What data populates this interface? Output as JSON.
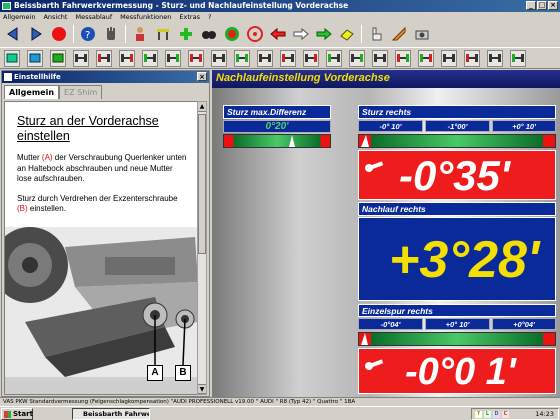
{
  "window": {
    "title": "Beissbarth Fahrwerkvermessung - Sturz- und Nachlaufeinstellung Vorderachse",
    "controls": [
      "_",
      "□",
      "×"
    ]
  },
  "menu": [
    "Allgemein",
    "Ansicht",
    "Messablauf",
    "Messfunktionen",
    "Extras",
    "?"
  ],
  "help": {
    "window_title": "Einstellhilfe",
    "tabs": [
      "Allgemein",
      "EZ Shim"
    ],
    "heading": "Sturz an der Vorderachse einstellen",
    "para1_a": "Mutter ",
    "para1_marker": "(A)",
    "para1_b": " der Verschraubung Querlenker unten an Haltebock abschrauben und neue Mutter lose aufschrauben.",
    "para2_a": "Sturz durch Verdrehen der Exzenterschraube ",
    "para2_marker": "(B)",
    "para2_b": " einstellen.",
    "callout_a": "A",
    "callout_b": "B"
  },
  "main": {
    "title": "Nachlaufeinstellung Vorderachse",
    "camber_diff": {
      "label": "Sturz max.Differenz",
      "value": "0°20'"
    },
    "camber_right": {
      "label": "Sturz rechts",
      "limits": [
        "-0° 10'",
        "-1°00'",
        "+0° 10'"
      ],
      "value": "-0°35'"
    },
    "caster_right": {
      "label": "Nachlauf rechts",
      "value": "+3°28'"
    },
    "toe_right": {
      "label": "Einzelspur rechts",
      "limits": [
        "-0°04'",
        "+0° 10'",
        "+0°04'"
      ],
      "value": "-0°0 1'"
    }
  },
  "status": "VAS PKW Standardvermessung (Felgenschlagkompensation) \"AUDI PROFESSIONELL v19.00 \" AUDI \" R8 (Typ 42) \" Quattro \" 1BA",
  "taskbar": {
    "start": "Start",
    "task": "Beissbarth Fahrwerkv...",
    "tray_icons": [
      "?",
      "L",
      "D",
      "C"
    ],
    "clock": "14:23"
  },
  "colors": {
    "title_yellow": "#f3e000",
    "panel_blue": "#0b2a9a",
    "value_red": "#ee1c1c",
    "gauge_green": "#2bb54a"
  }
}
